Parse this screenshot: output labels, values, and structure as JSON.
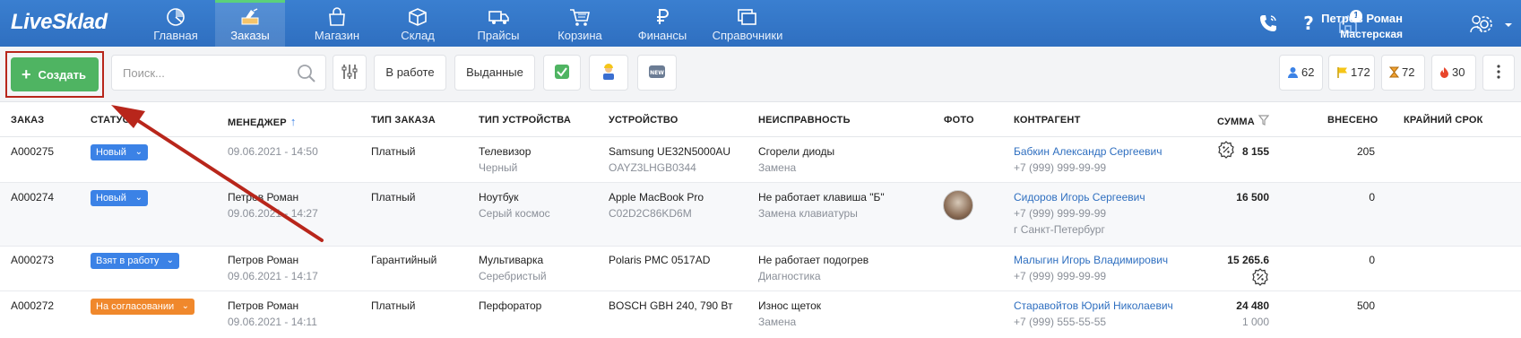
{
  "brand": {
    "name": "LiveSklad"
  },
  "nav": [
    {
      "label": "Главная",
      "icon": "dashboard-icon",
      "active": false
    },
    {
      "label": "Заказы",
      "icon": "orders-icon",
      "active": true
    },
    {
      "label": "Магазин",
      "icon": "shop-bag-icon",
      "active": false
    },
    {
      "label": "Склад",
      "icon": "warehouse-box-icon",
      "active": false
    },
    {
      "label": "Прайсы",
      "icon": "truck-icon",
      "active": false
    },
    {
      "label": "Корзина",
      "icon": "cart-icon",
      "active": false
    },
    {
      "label": "Финансы",
      "icon": "ruble-icon",
      "active": false
    },
    {
      "label": "Справочники",
      "icon": "directory-icon",
      "active": false
    }
  ],
  "header": {
    "notifications_count": "1",
    "user_name": "Петров Роман",
    "user_role": "Мастерская"
  },
  "toolbar": {
    "create_label": "Создать",
    "search_placeholder": "Поиск...",
    "filter_in_work": "В работе",
    "filter_issued": "Выданные",
    "counts": {
      "clients": "62",
      "flags": "172",
      "hourglass": "72",
      "fire": "30"
    }
  },
  "columns": {
    "order": "ЗАКАЗ",
    "status": "СТАТУС",
    "manager": "МЕНЕДЖЕР",
    "order_type": "ТИП ЗАКАЗА",
    "device_type": "ТИП УСТРОЙСТВА",
    "device": "УСТРОЙСТВО",
    "fault": "НЕИСПРАВНОСТЬ",
    "photo": "ФОТО",
    "contractor": "КОНТРАГЕНТ",
    "sum": "СУММА",
    "paid": "ВНЕСЕНО",
    "deadline": "КРАЙНИЙ СРОК"
  },
  "rows": [
    {
      "id": "A000275",
      "status": "Новый",
      "status_color": "#3b82e6",
      "manager": "",
      "date": "09.06.2021 - 14:50",
      "order_type": "Платный",
      "device_type": "Телевизор",
      "device_color": "Черный",
      "device": "Samsung UE32N5000AU",
      "serial": "OAYZ3LHGB0344",
      "fault": "Сгорели диоды",
      "work": "Замена",
      "contractor": "Бабкин Александр Сергеевич",
      "phone": "+7 (999) 999-99-99",
      "city": "",
      "sum": "8 155",
      "sum_sub": "",
      "paid": "205"
    },
    {
      "id": "A000274",
      "status": "Новый",
      "status_color": "#3b82e6",
      "manager": "Петров Роман",
      "date": "09.06.2021 - 14:27",
      "order_type": "Платный",
      "device_type": "Ноутбук",
      "device_color": "Серый космос",
      "device": "Apple MacBook Pro",
      "serial": "C02D2C86KD6M",
      "fault": "Не работает клавиша \"Б\"",
      "work": "Замена клавиатуры",
      "contractor": "Сидоров Игорь Сергеевич",
      "phone": "+7 (999) 999-99-99",
      "city": "г Санкт-Петербург",
      "sum": "16 500",
      "sum_sub": "",
      "paid": "0"
    },
    {
      "id": "A000273",
      "status": "Взят в работу",
      "status_color": "#3b82e6",
      "manager": "Петров Роман",
      "date": "09.06.2021 - 14:17",
      "order_type": "Гарантийный",
      "device_type": "Мультиварка",
      "device_color": "Серебристый",
      "device": "Polaris PMC 0517AD",
      "serial": "",
      "fault": "Не работает подогрев",
      "work": "Диагностика",
      "contractor": "Малыгин Игорь Владимирович",
      "phone": "+7 (999) 999-99-99",
      "city": "",
      "sum": "15 265.6",
      "sum_sub": "",
      "paid": "0"
    },
    {
      "id": "A000272",
      "status": "На согласовании",
      "status_color": "#f0882c",
      "manager": "Петров Роман",
      "date": "09.06.2021 - 14:11",
      "order_type": "Платный",
      "device_type": "Перфоратор",
      "device_color": "",
      "device": "BOSCH GBH 240, 790 Вт",
      "serial": "",
      "fault": "Износ щеток",
      "work": "Замена",
      "contractor": "Старавойтов Юрий Николаевич",
      "phone": "+7 (999) 555-55-55",
      "city": "",
      "sum": "24 480",
      "sum_sub": "1 000",
      "paid": "500"
    }
  ],
  "colors": {
    "header_bg": "#2f6fc0",
    "accent_green": "#4fb462",
    "annotation_red": "#b8261b",
    "link": "#2f6fc0"
  }
}
